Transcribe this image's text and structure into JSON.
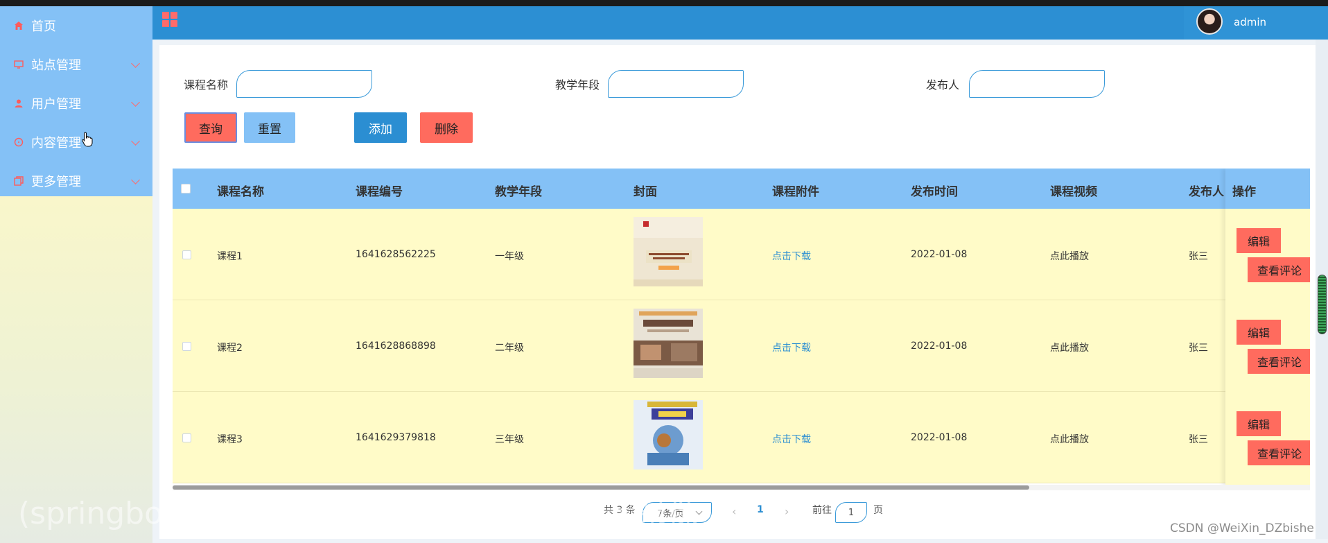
{
  "sidebar": {
    "items": [
      {
        "label": "首页",
        "icon": "home-icon",
        "has_submenu": false
      },
      {
        "label": "站点管理",
        "icon": "monitor-icon",
        "has_submenu": true
      },
      {
        "label": "用户管理",
        "icon": "user-icon",
        "has_submenu": true
      },
      {
        "label": "内容管理",
        "icon": "chat-icon",
        "has_submenu": true
      },
      {
        "label": "更多管理",
        "icon": "copy-icon",
        "has_submenu": true
      }
    ]
  },
  "header": {
    "menu_icon": "grid-icon",
    "username": "admin"
  },
  "filters": {
    "course_name_label": "课程名称",
    "course_name_value": "",
    "grade_label": "教学年段",
    "grade_value": "",
    "publisher_label": "发布人",
    "publisher_value": ""
  },
  "toolbar": {
    "query_label": "查询",
    "reset_label": "重置",
    "add_label": "添加",
    "delete_label": "删除"
  },
  "table": {
    "columns": [
      "课程名称",
      "课程编号",
      "教学年段",
      "封面",
      "课程附件",
      "发布时间",
      "课程视频",
      "发布人",
      "操作"
    ],
    "rows": [
      {
        "name": "课程1",
        "code": "1641628562225",
        "grade": "一年级",
        "cover": "cover-book-1",
        "attachment": "点击下载",
        "date": "2022-01-08",
        "video": "点此播放",
        "publisher": "张三"
      },
      {
        "name": "课程2",
        "code": "1641628868898",
        "grade": "二年级",
        "cover": "cover-book-2",
        "attachment": "点击下载",
        "date": "2022-01-08",
        "video": "点此播放",
        "publisher": "张三"
      },
      {
        "name": "课程3",
        "code": "1641629379818",
        "grade": "三年级",
        "cover": "cover-book-3",
        "attachment": "点击下载",
        "date": "2022-01-08",
        "video": "点此播放",
        "publisher": "张三"
      }
    ],
    "edit_label": "编辑",
    "comment_label": "查看评论"
  },
  "pagination": {
    "total_text": "共 3 条",
    "page_size": "7条/页",
    "current_page": "1",
    "goto_prefix": "前往",
    "goto_value": "1",
    "goto_suffix": "页"
  },
  "overlay": {
    "watermark": "(springboot+mysql)优课在线教学系统 演示录像",
    "credit": "CSDN @WeiXin_DZbishe"
  },
  "colors": {
    "header_blue": "#2c8fd3",
    "menu_blue": "#84c1f6",
    "accent_red": "#ff6b5e",
    "row_yellow": "#fffbc8"
  }
}
